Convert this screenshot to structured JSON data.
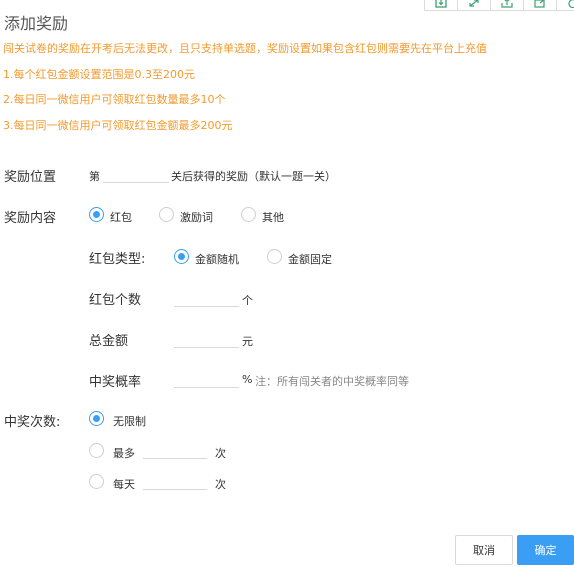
{
  "dialog": {
    "title": "添加奖励"
  },
  "toolbar": {
    "icons": [
      "download-icon",
      "expand-icon",
      "upload-icon",
      "export-icon",
      "refresh-icon"
    ]
  },
  "notice": {
    "main": "闯关试卷的奖励在开考后无法更改，且只支持单选题，奖励设置如果包含红包则需要先在平台上充值",
    "rules": [
      "1.每个红包金额设置范围是0.3至200元",
      "2.每日同一微信用户可领取红包数量最多10个",
      "3.每日同一微信用户可领取红包金额最多200元"
    ]
  },
  "reward_position": {
    "label": "奖励位置",
    "prefix": "第",
    "value": "",
    "suffix": "关后获得的奖励（默认一题一关）"
  },
  "reward_content": {
    "label": "奖励内容",
    "options": [
      {
        "label": "红包",
        "selected": true
      },
      {
        "label": "激励词",
        "selected": false
      },
      {
        "label": "其他",
        "selected": false
      }
    ]
  },
  "red_packet": {
    "type_label": "红包类型:",
    "type_options": [
      {
        "label": "金额随机",
        "selected": true
      },
      {
        "label": "金额固定",
        "selected": false
      }
    ],
    "count_label": "红包个数",
    "count_value": "",
    "count_unit": "个",
    "total_label": "总金额",
    "total_value": "",
    "total_unit": "元",
    "prob_label": "中奖概率",
    "prob_value": "",
    "prob_unit": "%",
    "prob_note": "注：所有闯关者的中奖概率同等"
  },
  "win_times": {
    "label": "中奖次数:",
    "options": [
      {
        "label": "无限制",
        "selected": true
      },
      {
        "label": "最多",
        "selected": false,
        "value": "",
        "unit": "次"
      },
      {
        "label": "每天",
        "selected": false,
        "value": "",
        "unit": "次"
      }
    ]
  },
  "actions": {
    "cancel": "取消",
    "confirm": "确定"
  },
  "colors": {
    "accent": "#3a9ef5",
    "warning": "#f39a2d"
  }
}
